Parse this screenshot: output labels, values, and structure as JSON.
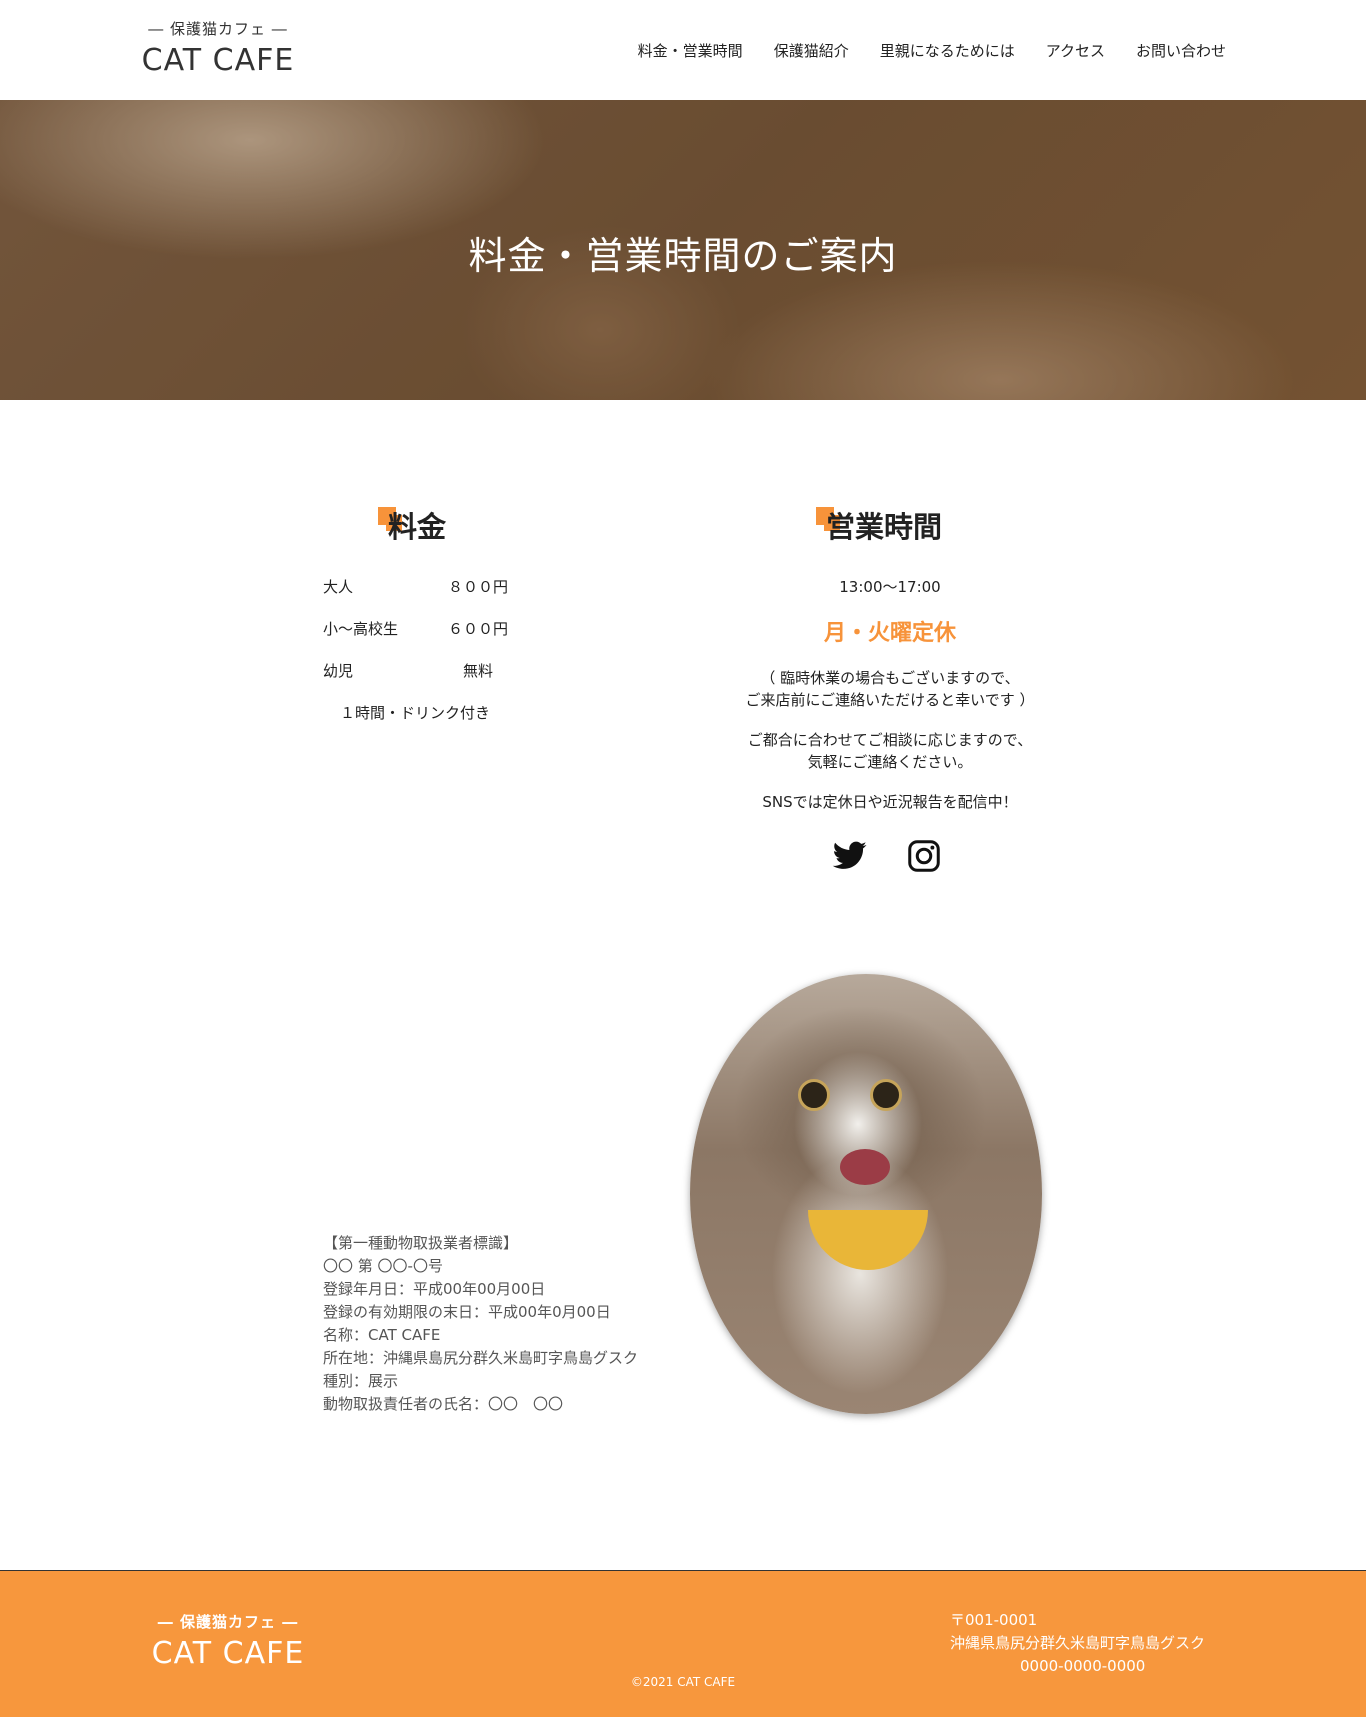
{
  "header": {
    "logo_sub": "― 保護猫カフェ ―",
    "logo_main": "CAT CAFE",
    "nav": [
      "料金・営業時間",
      "保護猫紹介",
      "里親になるためには",
      "アクセス",
      "お問い合わせ"
    ]
  },
  "hero": {
    "title": "料金・営業時間のご案内"
  },
  "price": {
    "title": "料金",
    "rows": [
      {
        "label": "大人",
        "value": "８００円"
      },
      {
        "label": "小〜高校生",
        "value": "６００円"
      },
      {
        "label": "幼児",
        "value": "無料"
      }
    ],
    "note": "１時間・ドリンク付き"
  },
  "hours": {
    "title": "営業時間",
    "time": "13:00〜17:00",
    "closed": "月・火曜定休",
    "note1_line1": "（ 臨時休業の場合もございますので、",
    "note1_line2": "ご来店前にご連絡いただけると幸いです ）",
    "note2_line1": "ご都合に合わせてご相談に応じますので、",
    "note2_line2": "気軽にご連絡ください。",
    "sns": "SNSでは定休日や近況報告を配信中！"
  },
  "social": {
    "icons": [
      "twitter-icon",
      "instagram-icon"
    ]
  },
  "registration": [
    "【第一種動物取扱業者標識】",
    "〇〇 第 〇〇-〇号",
    "登録年月日：平成00年00月00日",
    "登録の有効期限の末日：平成00年0月00日",
    "名称：CAT CAFE",
    "所在地：沖縄県島尻分群久米島町字鳥島グスク",
    "種別：展示",
    "動物取扱責任者の氏名：〇〇　〇〇"
  ],
  "footer": {
    "logo_sub": "― 保護猫カフェ ―",
    "logo_main": "CAT CAFE",
    "copyright": "©2021 CAT CAFE",
    "postal": "〒001-0001",
    "address": "沖縄県鳥尻分群久米島町字鳥島グスク",
    "tel": "0000-0000-0000"
  },
  "colors": {
    "accent": "#f7933a",
    "footer_bg": "#f7973d"
  }
}
